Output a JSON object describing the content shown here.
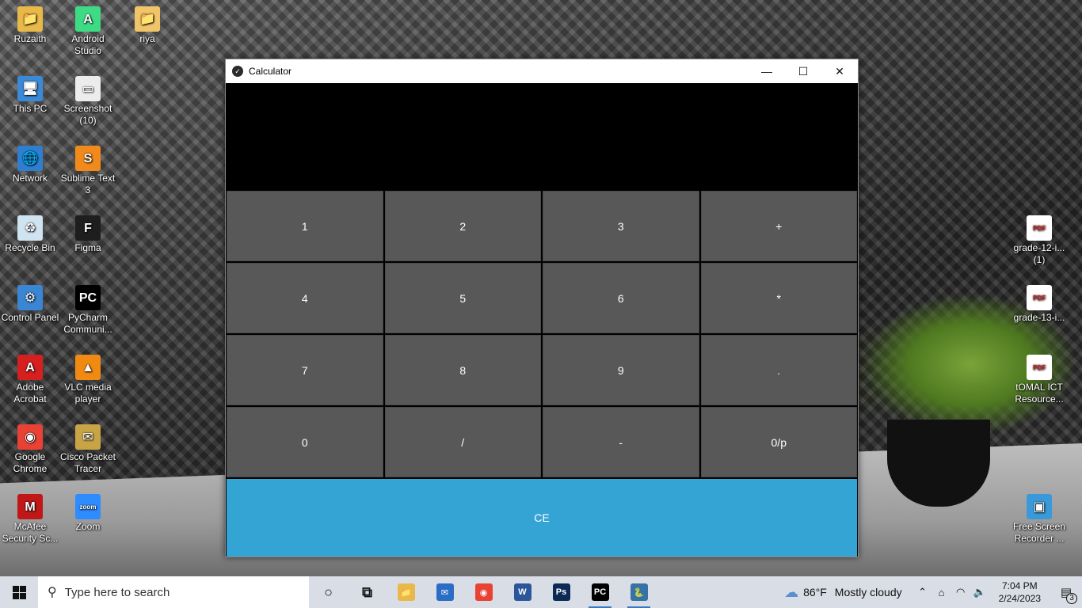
{
  "desktop": {
    "icons_left": [
      {
        "label": "Ruzaith",
        "icon": "user-folder-icon",
        "glyph": "📁",
        "color": "#e8b948"
      },
      {
        "label": "Android Studio",
        "icon": "android-studio-icon",
        "glyph": "A",
        "color": "#3ddc84"
      },
      {
        "label": "riya",
        "icon": "folder-icon",
        "glyph": "📁",
        "color": "#f0c56a"
      },
      {
        "label": "This PC",
        "icon": "this-pc-icon",
        "glyph": "🖥",
        "color": "#3a8ad8"
      },
      {
        "label": "Screenshot (10)",
        "icon": "screenshot-icon",
        "glyph": "▭",
        "color": "#ececec"
      },
      {
        "label": "Network",
        "icon": "network-icon",
        "glyph": "🌐",
        "color": "#2f7fd0"
      },
      {
        "label": "Sublime Text 3",
        "icon": "sublime-text-icon",
        "glyph": "S",
        "color": "#f28a1b"
      },
      {
        "label": "Recycle Bin",
        "icon": "recycle-bin-icon",
        "glyph": "♻",
        "color": "#cfe3f0"
      },
      {
        "label": "Figma",
        "icon": "figma-icon",
        "glyph": "F",
        "color": "#1e1e1e"
      },
      {
        "label": "Control Panel",
        "icon": "control-panel-icon",
        "glyph": "⚙",
        "color": "#3b86d4"
      },
      {
        "label": "PyCharm Communi...",
        "icon": "pycharm-icon",
        "glyph": "PC",
        "color": "#000000"
      },
      {
        "label": "Adobe Acrobat",
        "icon": "adobe-acrobat-icon",
        "glyph": "A",
        "color": "#d61f1f"
      },
      {
        "label": "VLC media player",
        "icon": "vlc-icon",
        "glyph": "▲",
        "color": "#f08a12"
      },
      {
        "label": "Google Chrome",
        "icon": "google-chrome-icon",
        "glyph": "◉",
        "color": "#e94235"
      },
      {
        "label": "Cisco Packet Tracer",
        "icon": "cisco-packet-tracer-icon",
        "glyph": "✉",
        "color": "#c8a446"
      },
      {
        "label": "McAfee Security Sc...",
        "icon": "mcafee-icon",
        "glyph": "M",
        "color": "#c01818"
      },
      {
        "label": "Zoom",
        "icon": "zoom-icon",
        "glyph": "zoom",
        "color": "#2d8cff"
      }
    ],
    "icons_right": [
      {
        "label": "grade-12-i... (1)",
        "icon": "pdf-file-icon",
        "glyph": "PDF",
        "color": "#ffffff"
      },
      {
        "label": "grade-13-i...",
        "icon": "pdf-file-icon",
        "glyph": "PDF",
        "color": "#ffffff"
      },
      {
        "label": "tOMAL ICT Resource...",
        "icon": "pdf-file-icon",
        "glyph": "PDF",
        "color": "#ffffff"
      },
      {
        "label": "Free Screen Recorder ...",
        "icon": "screen-recorder-icon",
        "glyph": "▣",
        "color": "#3a9ad9"
      }
    ]
  },
  "calculator": {
    "title": "Calculator",
    "display": "",
    "keys": [
      "1",
      "2",
      "3",
      "+",
      "4",
      "5",
      "6",
      "*",
      "7",
      "8",
      "9",
      ".",
      "0",
      "/",
      "-",
      "0/p"
    ],
    "clear_label": "CE",
    "accent_color": "#33a4d4",
    "key_color": "#585858"
  },
  "taskbar": {
    "search_placeholder": "Type here to search",
    "apps": [
      {
        "name": "cortana-icon",
        "glyph": "○",
        "color": "#111111",
        "running": false
      },
      {
        "name": "task-view-icon",
        "glyph": "⧉",
        "color": "#111111",
        "running": false
      },
      {
        "name": "file-explorer-icon",
        "glyph": "📁",
        "color": "#e8b948",
        "running": false
      },
      {
        "name": "mail-icon",
        "glyph": "✉",
        "color": "#2b6cc4",
        "running": false
      },
      {
        "name": "google-chrome-icon",
        "glyph": "◉",
        "color": "#e94235",
        "running": false
      },
      {
        "name": "word-icon",
        "glyph": "W",
        "color": "#2b579a",
        "running": false
      },
      {
        "name": "photoshop-icon",
        "glyph": "Ps",
        "color": "#0b2a55",
        "running": false
      },
      {
        "name": "pycharm-icon",
        "glyph": "PC",
        "color": "#000000",
        "running": true
      },
      {
        "name": "python-icon",
        "glyph": "🐍",
        "color": "#3572a5",
        "running": true
      }
    ],
    "weather": {
      "temp": "86°F",
      "condition": "Mostly cloudy"
    },
    "time": "7:04 PM",
    "date": "2/24/2023",
    "notification_count": "3"
  }
}
